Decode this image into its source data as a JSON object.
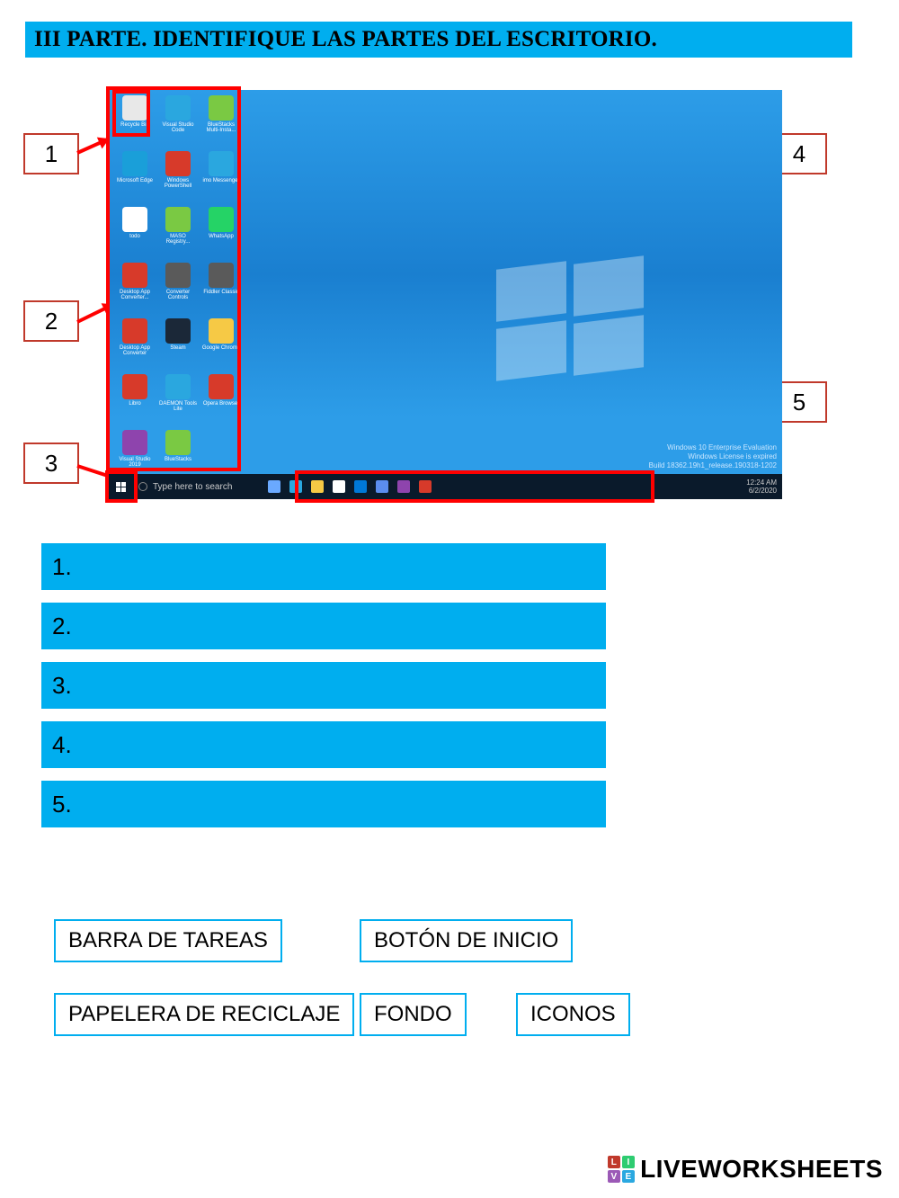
{
  "title": "III PARTE. IDENTIFIQUE LAS PARTES DEL ESCRITORIO.",
  "labels": {
    "n1": "1",
    "n2": "2",
    "n3": "3",
    "n4": "4",
    "n5": "5"
  },
  "answers": {
    "a1": "1.",
    "a2": "2.",
    "a3": "3.",
    "a4": "4.",
    "a5": "5."
  },
  "options": {
    "o1": "BARRA DE TAREAS",
    "o2": "BOTÓN DE INICIO",
    "o3": "PAPELERA DE RECICLAJE",
    "o4": "FONDO",
    "o5": "ICONOS"
  },
  "taskbar": {
    "search": "Type here to search",
    "time": "12:24 AM",
    "date": "6/2/2020"
  },
  "watermark": {
    "l1": "Windows 10 Enterprise Evaluation",
    "l2": "Windows License is expired",
    "l3": "Build 18362.19h1_release.190318-1202"
  },
  "icons": [
    {
      "label": "Recycle Bin",
      "color": "#e8e8e8"
    },
    {
      "label": "Visual Studio Code",
      "color": "#2aa7df"
    },
    {
      "label": "BlueStacks Multi-Insta...",
      "color": "#7ac943"
    },
    {
      "label": "Microsoft Edge",
      "color": "#1a9fd9"
    },
    {
      "label": "Windows PowerShell",
      "color": "#d73a2a"
    },
    {
      "label": "imo Messenger",
      "color": "#2aa7df"
    },
    {
      "label": "todo",
      "color": "#ffffff"
    },
    {
      "label": "MASO Registry...",
      "color": "#7ac943"
    },
    {
      "label": "WhatsApp",
      "color": "#25d366"
    },
    {
      "label": "Desktop App Converter...",
      "color": "#d73a2a"
    },
    {
      "label": "Converter Controls",
      "color": "#5a5a5a"
    },
    {
      "label": "Fiddler Classic",
      "color": "#5a5a5a"
    },
    {
      "label": "Desktop App Converter",
      "color": "#d73a2a"
    },
    {
      "label": "Steam",
      "color": "#1b2838"
    },
    {
      "label": "Google Chrome",
      "color": "#f6c945"
    },
    {
      "label": "Libro",
      "color": "#d73a2a"
    },
    {
      "label": "DAEMON Tools Lite",
      "color": "#2aa7df"
    },
    {
      "label": "Opera Browser",
      "color": "#d73a2a"
    },
    {
      "label": "Visual Studio 2019",
      "color": "#8e44ad"
    },
    {
      "label": "BlueStacks",
      "color": "#7ac943"
    }
  ],
  "task_icons": [
    "#6aa9ff",
    "#2aa7df",
    "#f6c945",
    "#ffffff",
    "#0078d7",
    "#5b8def",
    "#8e44ad",
    "#d73a2a"
  ],
  "brand": "LIVEWORKSHEETS"
}
